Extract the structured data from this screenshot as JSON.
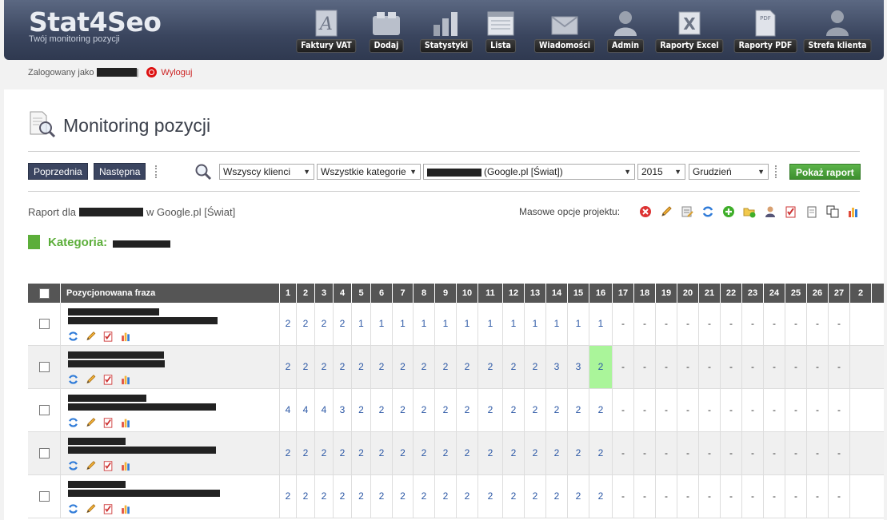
{
  "app": {
    "name": "Stat4Seo",
    "tagline": "Twój monitoring pozycji"
  },
  "nav": [
    {
      "label": "Faktury VAT",
      "icon": "invoice-icon"
    },
    {
      "label": "Dodaj",
      "icon": "add-icon"
    },
    {
      "label": "Statystyki",
      "icon": "stats-icon"
    },
    {
      "label": "Lista",
      "icon": "list-icon"
    },
    {
      "label": "Wiadomości",
      "icon": "mail-icon"
    },
    {
      "label": "Admin",
      "icon": "admin-icon"
    },
    {
      "label": "Raporty Excel",
      "icon": "excel-icon"
    },
    {
      "label": "Raporty PDF",
      "icon": "pdf-icon"
    },
    {
      "label": "Strefa klienta",
      "icon": "client-icon"
    }
  ],
  "login": {
    "prefix": "Zalogowany jako",
    "separator": "|",
    "logout": "Wyloguj"
  },
  "page": {
    "title": "Monitoring pozycji"
  },
  "toolbar": {
    "prev": "Poprzednia",
    "next": "Następna",
    "clients": "Wszyscy klienci",
    "categories": "Wszystkie kategorie",
    "project": "(Google.pl [Świat])",
    "year": "2015",
    "month": "Grudzień",
    "show": "Pokaż raport"
  },
  "report": {
    "prefix": "Raport dla",
    "suffix": "w Google.pl [Świat]",
    "mass_label": "Masowe opcje projektu:"
  },
  "category": {
    "label": "Kategoria:"
  },
  "table": {
    "phrase_header": "Pozycjonowana fraza",
    "days": [
      "1",
      "2",
      "3",
      "4",
      "5",
      "6",
      "7",
      "8",
      "9",
      "10",
      "11",
      "12",
      "13",
      "14",
      "15",
      "16",
      "17",
      "18",
      "19",
      "20",
      "21",
      "22",
      "23",
      "24",
      "25",
      "26",
      "27",
      "2"
    ],
    "rows": [
      {
        "values": [
          "2",
          "2",
          "2",
          "2",
          "1",
          "1",
          "1",
          "1",
          "1",
          "1",
          "1",
          "1",
          "1",
          "1",
          "1",
          "1",
          "-",
          "-",
          "-",
          "-",
          "-",
          "-",
          "-",
          "-",
          "-",
          "-",
          "-"
        ]
      },
      {
        "values": [
          "2",
          "2",
          "2",
          "2",
          "2",
          "2",
          "2",
          "2",
          "2",
          "2",
          "2",
          "2",
          "2",
          "3",
          "3",
          "2",
          "-",
          "-",
          "-",
          "-",
          "-",
          "-",
          "-",
          "-",
          "-",
          "-",
          "-"
        ]
      },
      {
        "values": [
          "4",
          "4",
          "4",
          "3",
          "2",
          "2",
          "2",
          "2",
          "2",
          "2",
          "2",
          "2",
          "2",
          "2",
          "2",
          "2",
          "-",
          "-",
          "-",
          "-",
          "-",
          "-",
          "-",
          "-",
          "-",
          "-",
          "-"
        ]
      },
      {
        "values": [
          "2",
          "2",
          "2",
          "2",
          "2",
          "2",
          "2",
          "2",
          "2",
          "2",
          "2",
          "2",
          "2",
          "2",
          "2",
          "2",
          "-",
          "-",
          "-",
          "-",
          "-",
          "-",
          "-",
          "-",
          "-",
          "-",
          "-"
        ]
      },
      {
        "values": [
          "2",
          "2",
          "2",
          "2",
          "2",
          "2",
          "2",
          "2",
          "2",
          "2",
          "2",
          "2",
          "2",
          "2",
          "2",
          "2",
          "-",
          "-",
          "-",
          "-",
          "-",
          "-",
          "-",
          "-",
          "-",
          "-",
          "-"
        ]
      }
    ]
  },
  "colors": {
    "accent": "#5cae3a",
    "header": "#3a455e",
    "highlight": "#aaf59a",
    "link": "#2b57a5"
  }
}
